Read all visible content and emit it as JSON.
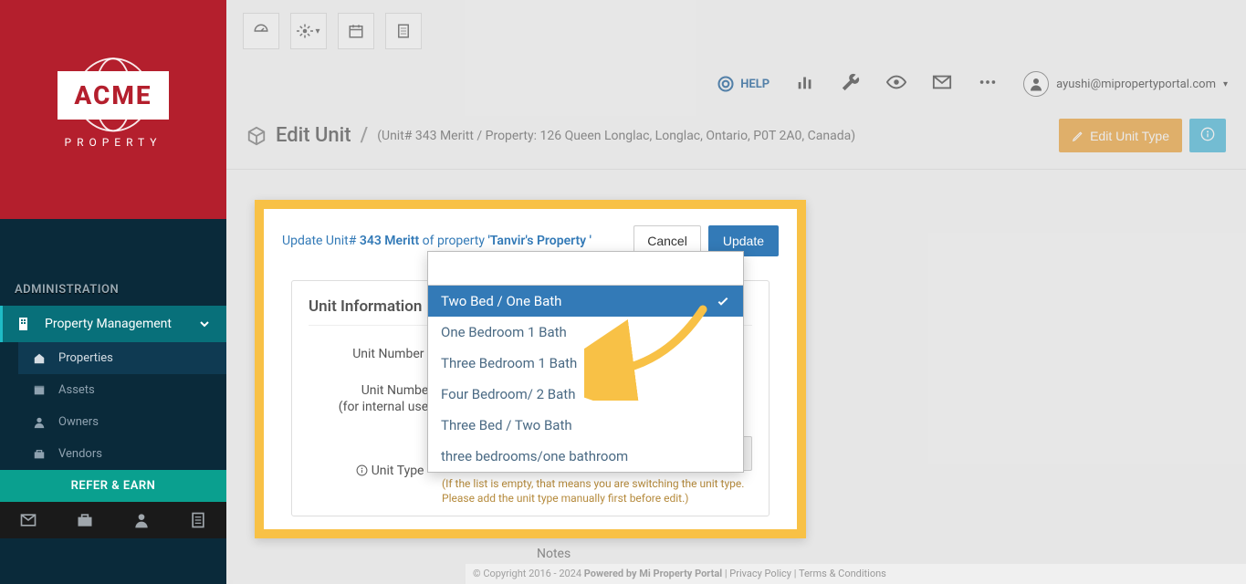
{
  "brand": {
    "name": "ACME",
    "sub": "PROPERTY"
  },
  "sidebar": {
    "admin_label": "ADMINISTRATION",
    "main_item": "Property Management",
    "subs": [
      "Properties",
      "Assets",
      "Owners",
      "Vendors"
    ],
    "refer": "REFER & EARN"
  },
  "topbar": {
    "help": "HELP",
    "user_email": "ayushi@mipropertyportal.com"
  },
  "page": {
    "title": "Edit Unit",
    "subtitle": "(Unit# 343 Meritt / Property: 126 Queen Longlac, Longlac, Ontario, P0T 2A0, Canada)",
    "edit_type_btn": "Edit Unit Type"
  },
  "modal": {
    "prefix": "Update Unit#",
    "unit_no": "343 Meritt",
    "mid": " of property ",
    "property": "'Tanvir's Property '",
    "cancel": "Cancel",
    "update": "Update",
    "section": "Unit Information",
    "labels": {
      "unit_number": "Unit Number",
      "unit_number_internal_l1": "Unit Number",
      "unit_number_internal_l2": "(for internal use)",
      "unit_type": "Unit Type",
      "notes": "Notes"
    },
    "selected_type": "Two Bed / One Bath",
    "hint": "(If the list is empty, that means you are switching the unit type. Please add the unit type manually first before edit.)"
  },
  "dropdown": {
    "options": [
      "Two Bed / One Bath",
      "One Bedroom 1 Bath",
      "Three Bedroom 1 Bath",
      "Four Bedroom/ 2 Bath",
      "Three Bed / Two Bath",
      "three bedrooms/one bathroom"
    ],
    "search_placeholder": ""
  },
  "footer": {
    "copyright": "© Copyright 2016 - 2024 ",
    "powered": "Powered by Mi Property Portal",
    "sep": " | ",
    "privacy": "Privacy Policy",
    "terms": "Terms & Conditions"
  }
}
